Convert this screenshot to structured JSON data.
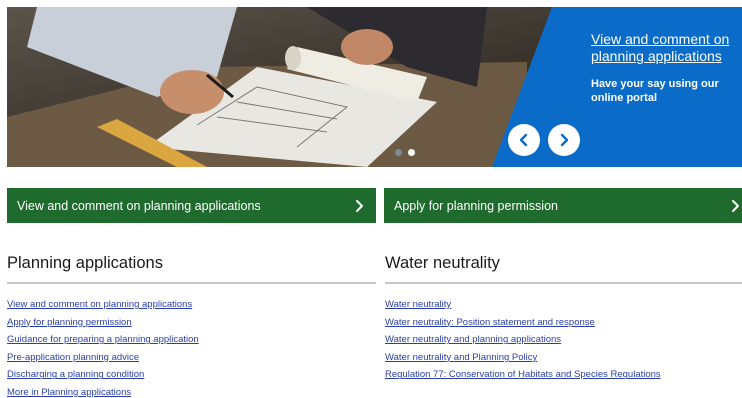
{
  "hero": {
    "title": "View and comment on planning applications",
    "subtitle": "Have your say using our online portal",
    "prev_icon": "chevron-left-icon",
    "next_icon": "chevron-right-icon",
    "slide_count": 2,
    "active_slide": 1,
    "panel_color": "#0b6bc8"
  },
  "quick_links": [
    {
      "label": "View and comment on planning applications",
      "icon": "chevron-right-icon"
    },
    {
      "label": "Apply for planning permission",
      "icon": "chevron-right-icon"
    }
  ],
  "sections": [
    {
      "heading": "Planning applications",
      "links": [
        "View and comment on planning applications",
        "Apply for planning permission",
        "Guidance for preparing a planning application",
        "Pre-application planning advice",
        "Discharging a planning condition",
        "More in Planning applications"
      ]
    },
    {
      "heading": "Water neutrality",
      "links": [
        "Water neutrality",
        "Water neutrality: Position statement and response",
        "Water neutrality and planning applications",
        "Water neutrality and Planning Policy",
        "Regulation 77: Conservation of Habitats and Species Regulations"
      ]
    }
  ],
  "colors": {
    "accent_green": "#1f6b2d",
    "link_blue": "#2a3fa8",
    "hero_blue": "#0b6bc8"
  }
}
